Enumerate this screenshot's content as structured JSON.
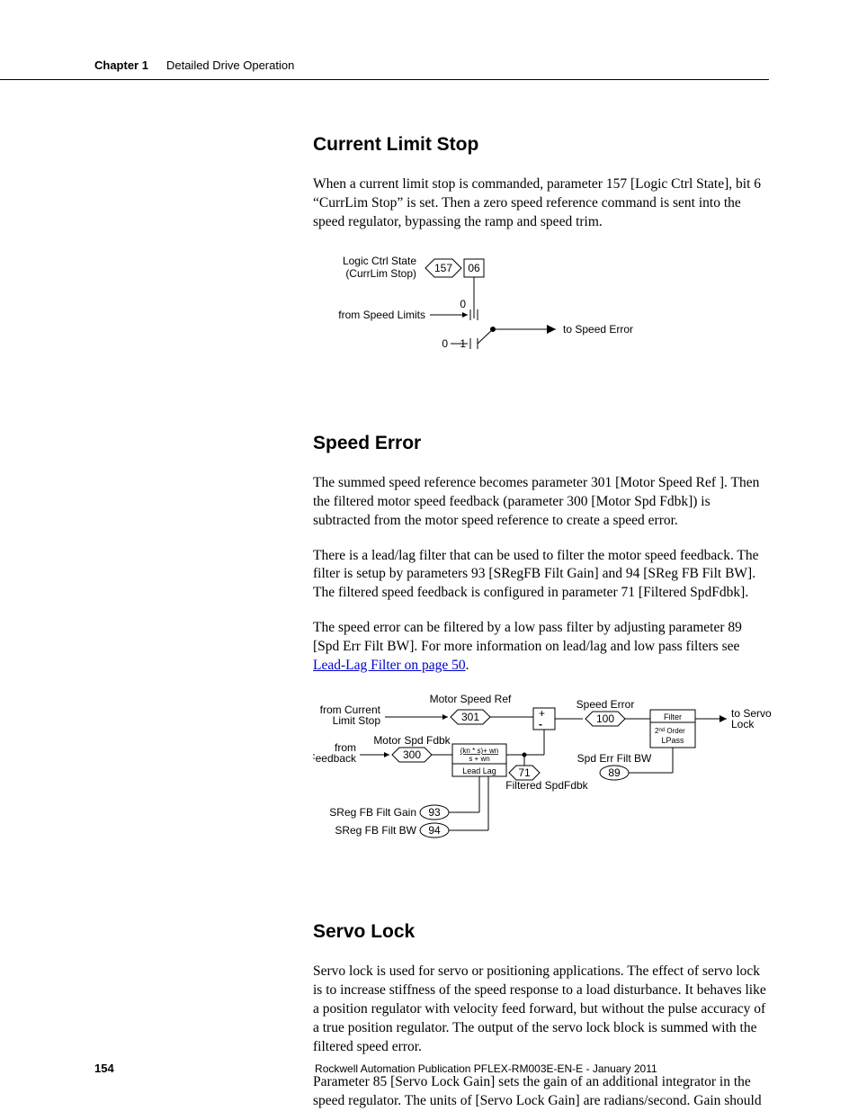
{
  "header": {
    "chapter_label": "Chapter 1",
    "chapter_title": "Detailed Drive Operation"
  },
  "sections": {
    "s1": {
      "heading": "Current Limit Stop",
      "p1": "When a current limit stop is commanded, parameter 157 [Logic Ctrl State], bit 6 “CurrLim Stop” is set. Then a zero speed reference command is sent into the speed regulator, bypassing the ramp and speed trim."
    },
    "s2": {
      "heading": "Speed Error",
      "p1": "The summed speed reference becomes parameter 301 [Motor Speed Ref ]. Then the filtered motor speed feedback (parameter 300 [Motor Spd Fdbk]) is subtracted from the motor speed reference to create a speed error.",
      "p2": "There is a lead/lag filter that can be used to filter the motor speed feedback. The filter is setup by parameters 93 [SRegFB Filt Gain] and 94 [SReg FB Filt BW]. The filtered speed feedback is configured in parameter 71 [Filtered SpdFdbk].",
      "p3a": "The speed error can be filtered by a low pass filter by adjusting parameter 89 [Spd Err Filt BW]. For more information on lead/lag and low pass filters see ",
      "p3link": "Lead-Lag Filter on page 50",
      "p3b": "."
    },
    "s3": {
      "heading": "Servo Lock",
      "p1": "Servo lock is used for servo or positioning applications. The effect of servo lock is to increase stiffness of the speed response to a load disturbance. It behaves like a position regulator with velocity feed forward, but without the pulse accuracy of a true position regulator. The output of the servo lock block is summed with the filtered speed error.",
      "p2": "Parameter 85 [Servo Lock Gain] sets the gain of an additional integrator in the speed regulator. The units of [Servo Lock Gain] are radians/second. Gain should"
    }
  },
  "diagram1": {
    "lbl_logic1": "Logic Ctrl State",
    "lbl_logic2": "(CurrLim Stop)",
    "p157": "157",
    "p06": "06",
    "from_speed": "from Speed Limits",
    "to_speed": "to Speed Error",
    "zero_a": "0",
    "one": "1",
    "zero_b": "0"
  },
  "diagram2": {
    "motor_speed_ref": "Motor Speed Ref",
    "from_current1": "from Current",
    "from_current2": "Limit Stop",
    "p301": "301",
    "motor_spd_fdbk": "Motor Spd Fdbk",
    "from_fdbk1": "from",
    "from_fdbk2": "Feedback",
    "p300": "300",
    "formula1": "(kn * s)+ wn",
    "formula2": "s + wn",
    "lead_lag": "Lead Lag",
    "p71": "71",
    "filtered_spdfdbk": "Filtered SpdFdbk",
    "sreg_gain": "SReg FB Filt Gain",
    "p93": "93",
    "sreg_bw": "SReg FB Filt BW",
    "p94": "94",
    "plus": "+",
    "minus": "-",
    "speed_error": "Speed Error",
    "p100": "100",
    "filter": "Filter",
    "lpass1": "2",
    "lpass2": "nd",
    "lpass3": " Order",
    "lpass4": "LPass",
    "spd_err_bw": "Spd Err Filt BW",
    "p89": "89",
    "to_servo1": "to Servo",
    "to_servo2": "Lock"
  },
  "footer": {
    "page": "154",
    "pub": "Rockwell Automation Publication PFLEX-RM003E-EN-E - January 2011"
  }
}
